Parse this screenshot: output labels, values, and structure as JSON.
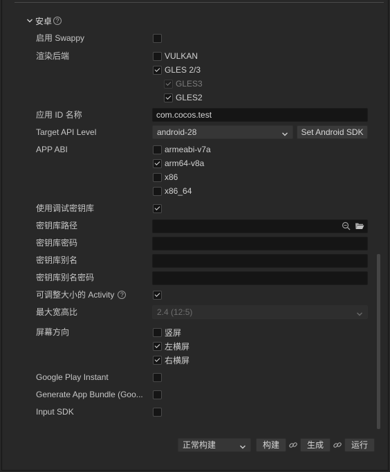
{
  "section": {
    "title": "安卓",
    "help": "?"
  },
  "fields": {
    "swappy": {
      "label": "启用 Swappy",
      "checked": false
    },
    "renderer": {
      "label": "渲染后端",
      "options": [
        {
          "label": "VULKAN",
          "checked": false
        },
        {
          "label": "GLES 2/3",
          "checked": true
        },
        {
          "label": "GLES3",
          "checked": true,
          "disabled": true
        },
        {
          "label": "GLES2",
          "checked": true
        }
      ]
    },
    "app_id": {
      "label": "应用 ID 名称",
      "value": "com.cocos.test"
    },
    "target_api": {
      "label": "Target API Level",
      "value": "android-28",
      "button": "Set Android SDK"
    },
    "app_abi": {
      "label": "APP ABI",
      "options": [
        {
          "label": "armeabi-v7a",
          "checked": false
        },
        {
          "label": "arm64-v8a",
          "checked": true
        },
        {
          "label": "x86",
          "checked": false
        },
        {
          "label": "x86_64",
          "checked": false
        }
      ]
    },
    "debug_keystore": {
      "label": "使用调试密钥库",
      "checked": true
    },
    "keystore_path": {
      "label": "密钥库路径",
      "value": ""
    },
    "keystore_password": {
      "label": "密钥库密码",
      "value": ""
    },
    "keystore_alias": {
      "label": "密钥库别名",
      "value": ""
    },
    "keystore_alias_password": {
      "label": "密钥库别名密码",
      "value": ""
    },
    "resizable_activity": {
      "label": "可调整大小的 Activity",
      "checked": true
    },
    "max_aspect_ratio": {
      "label": "最大宽高比",
      "value": "2.4 (12:5)"
    },
    "orientation": {
      "label": "屏幕方向",
      "options": [
        {
          "label": "竖屏",
          "checked": false
        },
        {
          "label": "左横屏",
          "checked": true
        },
        {
          "label": "右横屏",
          "checked": true
        }
      ]
    },
    "google_play_instant": {
      "label": "Google Play Instant",
      "checked": false
    },
    "app_bundle": {
      "label": "Generate App Bundle (Goo...",
      "checked": false
    },
    "input_sdk": {
      "label": "Input SDK",
      "checked": false
    }
  },
  "footer": {
    "build_mode": "正常构建",
    "build": "构建",
    "make": "生成",
    "run": "运行"
  },
  "colors": {
    "background": "#262626",
    "input": "#151515",
    "button": "#3a3a3a"
  }
}
